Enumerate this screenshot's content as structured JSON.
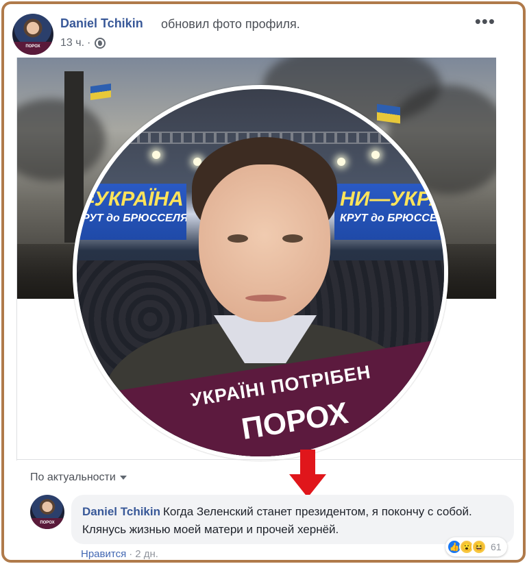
{
  "post": {
    "author": "Daniel Tchikin",
    "action_text": "обновил фото профиля.",
    "time": "13 ч.",
    "separator": "·",
    "more_icon": "more-horizontal-icon",
    "privacy_icon": "globe-icon",
    "avatar_slogan": "ПОРОХ"
  },
  "photo": {
    "banner_left": "=УКРАЇНА",
    "banner_left_sub": "РУТ до БРЮССЕЛЯ",
    "banner_right": "НИ—УКРАЇНА",
    "banner_right_sub": "КРУТ до БРЮССЕЛЯ",
    "slogan_line1": "УКРАЇНІ ПОТРІБЕН",
    "slogan_line2": "ПОРОХ",
    "slogan_color": "#5c1a3e"
  },
  "comments": {
    "sort_label": "По актуальности",
    "items": [
      {
        "author": "Daniel Tchikin",
        "text": "Когда Зеленский станет президентом, я покончу с собой. Клянусь жизнью моей матери и прочей хернёй.",
        "like_label": "Нравится",
        "separator": "·",
        "time": "2 дн.",
        "reactions": [
          "like-icon",
          "wow-icon",
          "haha-icon"
        ],
        "reaction_count": "61"
      }
    ]
  },
  "colors": {
    "link_blue": "#385898",
    "frame": "#b07a4a",
    "arrow": "#e0161b"
  }
}
